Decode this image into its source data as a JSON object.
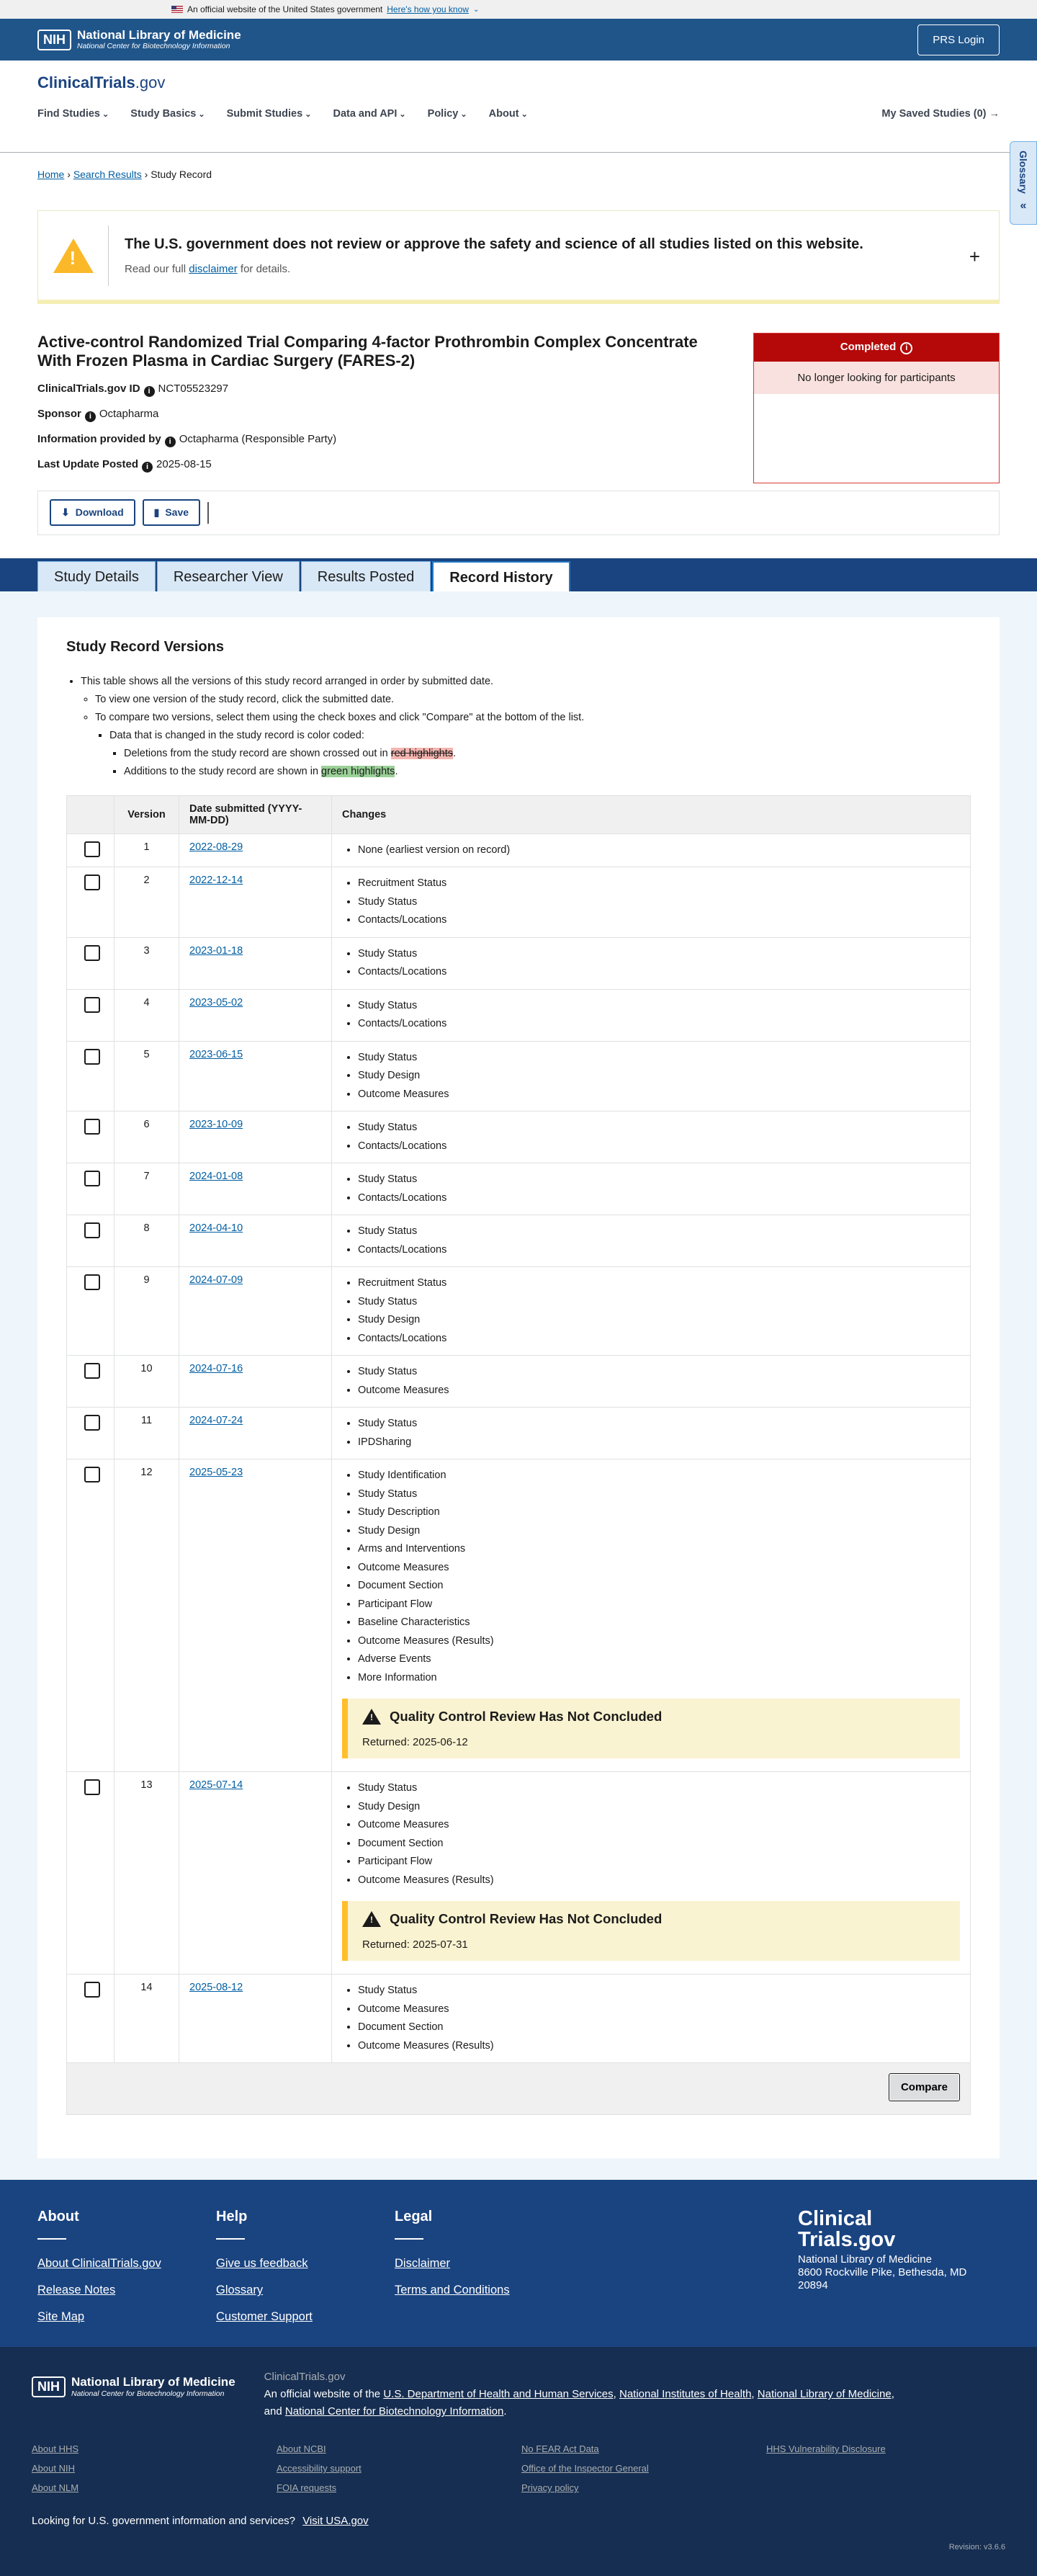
{
  "gov_banner": {
    "text": "An official website of the United States government",
    "link": "Here's how you know"
  },
  "nih": {
    "logo": "NIH",
    "name": "National Library of Medicine",
    "sub": "National Center for Biotechnology Information",
    "prs_login": "PRS Login"
  },
  "site": {
    "logo_main": "ClinicalTrials",
    "logo_tld": ".gov"
  },
  "nav": {
    "items": [
      "Find Studies",
      "Study Basics",
      "Submit Studies",
      "Data and API",
      "Policy",
      "About"
    ],
    "saved": "My Saved Studies (0) →"
  },
  "breadcrumb": {
    "home": "Home",
    "search": "Search Results",
    "current": "Study Record"
  },
  "glossary": "Glossary",
  "alert": {
    "title": "The U.S. government does not review or approve the safety and science of all studies listed on this website.",
    "pre": "Read our full",
    "link": "disclaimer",
    "post": "for details."
  },
  "study": {
    "title": "Active-control Randomized Trial Comparing 4-factor Prothrombin Complex Concentrate With Frozen Plasma in Cardiac Surgery (FARES-2)",
    "id_label": "ClinicalTrials.gov ID",
    "id": "NCT05523297",
    "sponsor_label": "Sponsor",
    "sponsor": "Octapharma",
    "info_label": "Information provided by",
    "info": "Octapharma (Responsible Party)",
    "update_label": "Last Update Posted",
    "update": "2025-08-15"
  },
  "status": {
    "label": "Completed",
    "sub": "No longer looking for participants"
  },
  "actions": {
    "download": "Download",
    "save": "Save"
  },
  "tabs": [
    "Study Details",
    "Researcher View",
    "Results Posted",
    "Record History"
  ],
  "versions": {
    "heading": "Study Record Versions",
    "intro1": "This table shows all the versions of this study record arranged in order by submitted date.",
    "intro2": "To view one version of the study record, click the submitted date.",
    "intro3": "To compare two versions, select them using the check boxes and click \"Compare\" at the bottom of the list.",
    "intro4": "Data that is changed in the study record is color coded:",
    "del_pre": "Deletions from the study record are shown crossed out in",
    "del_mark": "red highlights",
    "del_post": ".",
    "add_pre": "Additions to the study record are shown in",
    "add_mark": "green highlights",
    "add_post": ".",
    "col_version": "Version",
    "col_date": "Date submitted (YYYY-MM-DD)",
    "col_changes": "Changes",
    "compare": "Compare",
    "qc_title": "Quality Control Review Has Not Concluded",
    "qc_ret_12": "Returned: 2025-06-12",
    "qc_ret_13": "Returned: 2025-07-31",
    "rows": [
      {
        "v": "1",
        "d": "2022-08-29",
        "c": [
          "None (earliest version on record)"
        ]
      },
      {
        "v": "2",
        "d": "2022-12-14",
        "c": [
          "Recruitment Status",
          "Study Status",
          "Contacts/Locations"
        ]
      },
      {
        "v": "3",
        "d": "2023-01-18",
        "c": [
          "Study Status",
          "Contacts/Locations"
        ]
      },
      {
        "v": "4",
        "d": "2023-05-02",
        "c": [
          "Study Status",
          "Contacts/Locations"
        ]
      },
      {
        "v": "5",
        "d": "2023-06-15",
        "c": [
          "Study Status",
          "Study Design",
          "Outcome Measures"
        ]
      },
      {
        "v": "6",
        "d": "2023-10-09",
        "c": [
          "Study Status",
          "Contacts/Locations"
        ]
      },
      {
        "v": "7",
        "d": "2024-01-08",
        "c": [
          "Study Status",
          "Contacts/Locations"
        ]
      },
      {
        "v": "8",
        "d": "2024-04-10",
        "c": [
          "Study Status",
          "Contacts/Locations"
        ]
      },
      {
        "v": "9",
        "d": "2024-07-09",
        "c": [
          "Recruitment Status",
          "Study Status",
          "Study Design",
          "Contacts/Locations"
        ]
      },
      {
        "v": "10",
        "d": "2024-07-16",
        "c": [
          "Study Status",
          "Outcome Measures"
        ]
      },
      {
        "v": "11",
        "d": "2024-07-24",
        "c": [
          "Study Status",
          "IPDSharing"
        ]
      },
      {
        "v": "12",
        "d": "2025-05-23",
        "c": [
          "Study Identification",
          "Study Status",
          "Study Description",
          "Study Design",
          "Arms and Interventions",
          "Outcome Measures",
          "Document Section",
          "Participant Flow",
          "Baseline Characteristics",
          "Outcome Measures (Results)",
          "Adverse Events",
          "More Information"
        ]
      },
      {
        "v": "13",
        "d": "2025-07-14",
        "c": [
          "Study Status",
          "Study Design",
          "Outcome Measures",
          "Document Section",
          "Participant Flow",
          "Outcome Measures (Results)"
        ]
      },
      {
        "v": "14",
        "d": "2025-08-12",
        "c": [
          "Study Status",
          "Outcome Measures",
          "Document Section",
          "Outcome Measures (Results)"
        ]
      }
    ]
  },
  "footer": {
    "about_h": "About",
    "about_links": [
      "About ClinicalTrials.gov",
      "Release Notes",
      "Site Map"
    ],
    "help_h": "Help",
    "help_links": [
      "Give us feedback",
      "Glossary",
      "Customer Support"
    ],
    "legal_h": "Legal",
    "legal_links": [
      "Disclaimer",
      "Terms and Conditions"
    ],
    "logo1": "Clinical",
    "logo2": "Trials.gov",
    "addr1": "National Library of Medicine",
    "addr2": "8600 Rockville Pike, Bethesda, MD",
    "addr3": "20894",
    "bot_label": "ClinicalTrials.gov",
    "bot_pre": "An official website of the",
    "bot_l1": "U.S. Department of Health and Human Services",
    "bot_l2": "National Institutes of Health",
    "bot_l3": "National Library of Medicine",
    "bot_and": "and",
    "bot_l4": "National Center for Biotechnology Information",
    "links": [
      "About HHS",
      "About NCBI",
      "No FEAR Act Data",
      "HHS Vulnerability Disclosure",
      "About NIH",
      "Accessibility support",
      "Office of the Inspector General",
      "",
      "About NLM",
      "FOIA requests",
      "Privacy policy",
      ""
    ],
    "gov_text": "Looking for U.S. government information and services?",
    "gov_link": "Visit USA.gov",
    "revision": "Revision: v3.6.6"
  }
}
